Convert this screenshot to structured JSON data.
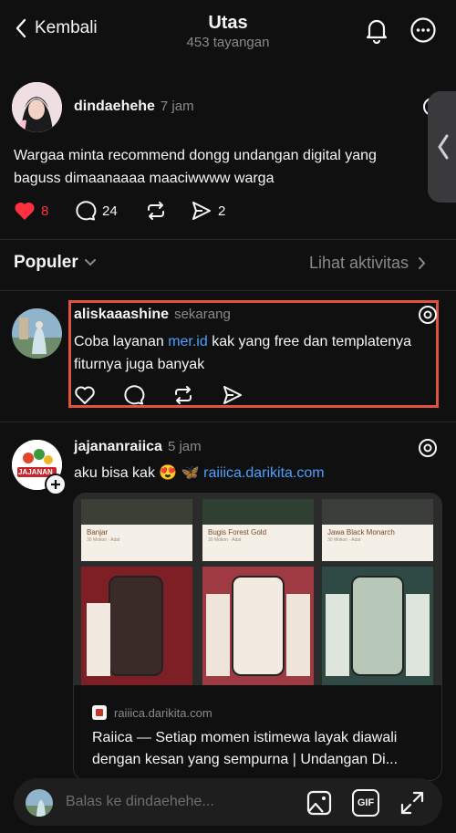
{
  "header": {
    "back_label": "Kembali",
    "title": "Utas",
    "subtitle": "453 tayangan"
  },
  "op": {
    "username": "dindaehehe",
    "time": "7 jam",
    "text_line1": "Wargaa minta recommend dongg undangan digital yang",
    "text_line2": "baguss dimaanaaaa maaciwwww warga",
    "likes": "8",
    "comments": "24",
    "shares": "2"
  },
  "sort": {
    "label": "Populer",
    "activity_label": "Lihat aktivitas"
  },
  "reply1": {
    "username": "aliskaaashine",
    "time": "sekarang",
    "text_pre": "Coba layanan ",
    "text_link": "mer.id",
    "text_post": " kak yang free dan templatenya",
    "text_line2": "fiturnya juga banyak"
  },
  "reply2": {
    "username": "jajananraiica",
    "time": "5 jam",
    "text_pre": "aku bisa kak 😍 🦋 ",
    "text_link": "raiiica.darikita.com",
    "avatar_text": "JAJANAN",
    "card_domain": "raiiica.darikita.com",
    "card_title_line1": "Raiica — Setiap momen istimewa layak diawali",
    "card_title_line2": "dengan kesan yang sempurna | Undangan Di...",
    "templates": [
      {
        "name": "Banjar",
        "sub": "30 Motion · Adat"
      },
      {
        "name": "Bugis Forest Gold",
        "sub": "30 Motion · Adat"
      },
      {
        "name": "Jawa Black Monarch",
        "sub": "30 Motion · Adat"
      }
    ]
  },
  "reply_bar": {
    "placeholder": "Balas ke dindaehehe...",
    "gif_label": "GIF"
  },
  "colors": {
    "background": "#101010",
    "like_red": "#ff3040",
    "link_blue": "#4aa0ff",
    "highlight_border": "#e0533f"
  }
}
